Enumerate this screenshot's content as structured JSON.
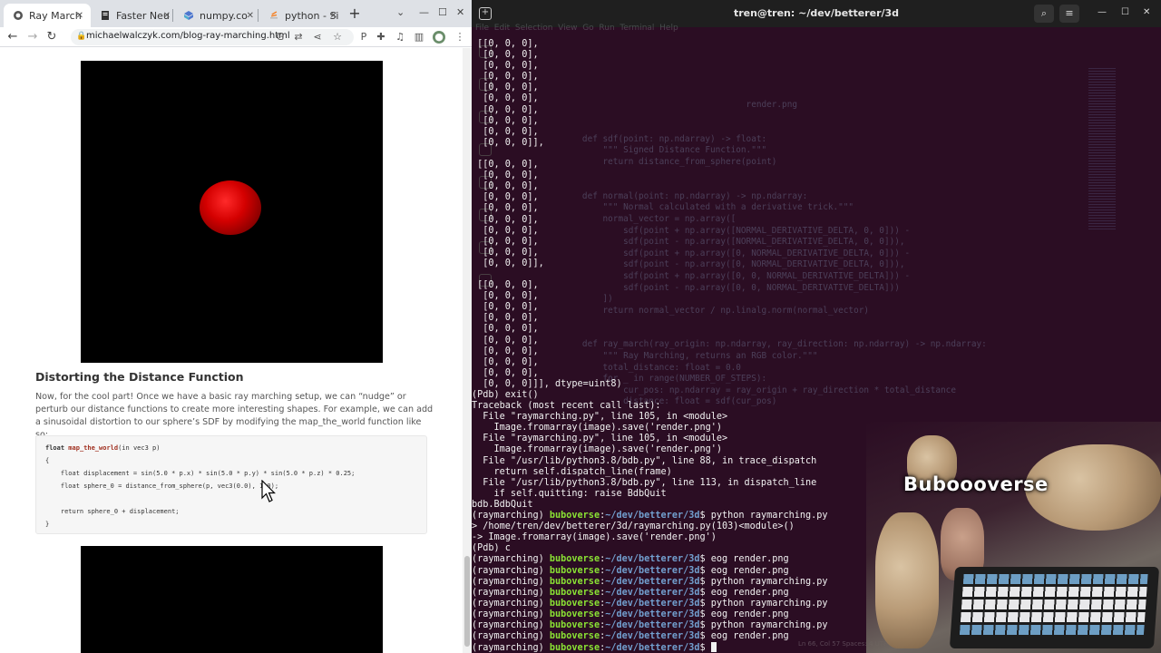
{
  "browser": {
    "tabs": [
      {
        "label": "Ray March",
        "active": true,
        "icon": "globe-icon"
      },
      {
        "label": "Faster Neu",
        "active": false,
        "icon": "document-icon"
      },
      {
        "label": "numpy.co",
        "active": false,
        "icon": "numpy-icon"
      },
      {
        "label": "python - Si",
        "active": false,
        "icon": "stackoverflow-icon"
      }
    ],
    "url": "michaelwalczyk.com/blog-ray-marching.html"
  },
  "article": {
    "heading": "Distorting the Distance Function",
    "paragraph": "Now, for the cool part! Once we have a basic ray marching setup, we can “nudge” or perturb our distance functions to create more interesting shapes. For example, we can add a sinusoidal distortion to our sphere’s SDF by modifying the map_the_world function like so:",
    "code": {
      "line1_type": "float ",
      "line1_fn": "map_the_world",
      "line1_rest": "(in vec3 p)",
      "line2": "{",
      "line3": "    float displacement = sin(5.0 * p.x) * sin(5.0 * p.y) * sin(5.0 * p.z) * 0.25;",
      "line4": "    float sphere_0 = distance_from_sphere(p, vec3(0.0), 1.0);",
      "line5": "    return sphere_0 + displacement;",
      "line6": "}"
    }
  },
  "terminal": {
    "title": "tren@tren: ~/dev/betterer/3d",
    "lines": [
      " [[0, 0, 0],",
      "  [0, 0, 0],",
      "  [0, 0, 0],",
      "  [0, 0, 0],",
      "  [0, 0, 0],",
      "  [0, 0, 0],",
      "  [0, 0, 0],",
      "  [0, 0, 0],",
      "  [0, 0, 0],",
      "  [0, 0, 0]],",
      "",
      " [[0, 0, 0],",
      "  [0, 0, 0],",
      "  [0, 0, 0],",
      "  [0, 0, 0],",
      "  [0, 0, 0],",
      "  [0, 0, 0],",
      "  [0, 0, 0],",
      "  [0, 0, 0],",
      "  [0, 0, 0],",
      "  [0, 0, 0]],",
      "",
      " [[0, 0, 0],",
      "  [0, 0, 0],",
      "  [0, 0, 0],",
      "  [0, 0, 0],",
      "  [0, 0, 0],",
      "  [0, 0, 0],",
      "  [0, 0, 0],",
      "  [0, 0, 0],",
      "  [0, 0, 0],",
      "  [0, 0, 0]]], dtype=uint8)",
      "(Pdb) exit()",
      "Traceback (most recent call last):",
      "  File \"raymarching.py\", line 105, in <module>",
      "    Image.fromarray(image).save('render.png')",
      "  File \"raymarching.py\", line 105, in <module>",
      "    Image.fromarray(image).save('render.png')",
      "  File \"/usr/lib/python3.8/bdb.py\", line 88, in trace_dispatch",
      "    return self.dispatch_line(frame)",
      "  File \"/usr/lib/python3.8/bdb.py\", line 113, in dispatch_line",
      "    if self.quitting: raise BdbQuit",
      "bdb.BdbQuit",
      "(raymarching) |buboverse|:|~/dev/betterer/3d|$ python raymarching.py",
      "> /home/tren/dev/betterer/3d/raymarching.py(103)<module>()",
      "-> Image.fromarray(image).save('render.png')",
      "(Pdb) c",
      "(raymarching) |buboverse|:|~/dev/betterer/3d|$ eog render.png",
      "(raymarching) |buboverse|:|~/dev/betterer/3d|$ eog render.png",
      "(raymarching) |buboverse|:|~/dev/betterer/3d|$ python raymarching.py",
      "(raymarching) |buboverse|:|~/dev/betterer/3d|$ eog render.png",
      "(raymarching) |buboverse|:|~/dev/betterer/3d|$ python raymarching.py",
      "(raymarching) |buboverse|:|~/dev/betterer/3d|$ eog render.png",
      "(raymarching) |buboverse|:|~/dev/betterer/3d|$ python raymarching.py",
      "(raymarching) |buboverse|:|~/dev/betterer/3d|$ eog render.png",
      "(raymarching) |buboverse|:|~/dev/betterer/3d|$ "
    ]
  },
  "ghost_editor": {
    "menu": "File  Edit  Selection  View  Go  Run  Terminal  Help",
    "code": [
      "                                   render.png",
      "",
      "",
      "   def sdf(point: np.ndarray) -> float:",
      "       \"\"\" Signed Distance Function.\"\"\"",
      "       return distance_from_sphere(point)",
      "",
      "",
      "   def normal(point: np.ndarray) -> np.ndarray:",
      "       \"\"\" Normal calculated with a derivative trick.\"\"\"",
      "       normal_vector = np.array([",
      "           sdf(point + np.array([NORMAL_DERIVATIVE_DELTA, 0, 0])) -",
      "           sdf(point - np.array([NORMAL_DERIVATIVE_DELTA, 0, 0])),",
      "           sdf(point + np.array([0, NORMAL_DERIVATIVE_DELTA, 0])) -",
      "           sdf(point - np.array([0, NORMAL_DERIVATIVE_DELTA, 0])),",
      "           sdf(point + np.array([0, 0, NORMAL_DERIVATIVE_DELTA])) -",
      "           sdf(point - np.array([0, 0, NORMAL_DERIVATIVE_DELTA]))",
      "       ])",
      "       return normal_vector / np.linalg.norm(normal_vector)",
      "",
      "",
      "   def ray_march(ray_origin: np.ndarray, ray_direction: np.ndarray) -> np.ndarray:",
      "       \"\"\" Ray Marching, returns an RGB color.\"\"\"",
      "       total_distance: float = 0.0",
      "       for _ in range(NUMBER_OF_STEPS):",
      "           cur_pos: np.ndarray = ray_origin + ray_direction * total_distance",
      "           distance: float = sdf(cur_pos)"
    ],
    "status": "Ln 66, Col 57    Spaces: 4    UTF-8"
  },
  "webcam": {
    "watermark": "Buboooverse"
  }
}
